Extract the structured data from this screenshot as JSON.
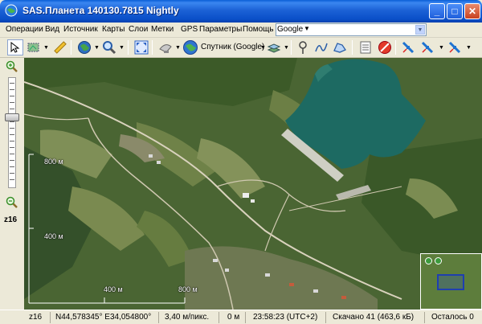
{
  "window": {
    "title": "SAS.Планета 140130.7815 Nightly",
    "minimize": "_",
    "maximize": "□",
    "close": "✕"
  },
  "menu": {
    "items": [
      "Операции",
      "Вид",
      "Источник",
      "Карты",
      "Слои",
      "Метки",
      "GPS",
      "Параметры",
      "Помощь"
    ],
    "search_provider": "Google",
    "search_value": ""
  },
  "toolbar": {
    "map_source": "Спутник (Google)",
    "icons": [
      "cursor-icon",
      "select-area-icon",
      "ruler-icon",
      "globe-icon",
      "magnifier-icon",
      "fullscreen-icon",
      "satellite-dish-icon",
      "globe-map-icon",
      "layers-icon",
      "placemark-icon",
      "path-icon",
      "polygon-icon",
      "marks-list-icon",
      "delete-marks-icon",
      "gps-satellite-icon",
      "gps-track-icon",
      "gps-settings-icon"
    ]
  },
  "zoom": {
    "level": "z16"
  },
  "map": {
    "scale_vertical": [
      "800 м",
      "400 м"
    ],
    "scale_horizontal": [
      "400 м",
      "800 м"
    ],
    "colors": {
      "reservoir": "#1c6b63",
      "forest": "#3d5a2a",
      "field": "#7a8a55"
    }
  },
  "status": {
    "zoom": "z16",
    "coordinates": "N44,578345° E34,054800°",
    "resolution": "3,40 м/пикс.",
    "elevation": "0 м",
    "time": "23:58:23 (UTC+2)",
    "downloaded": "Скачано 41 (463,6 кБ)",
    "remaining": "Осталось 0"
  }
}
